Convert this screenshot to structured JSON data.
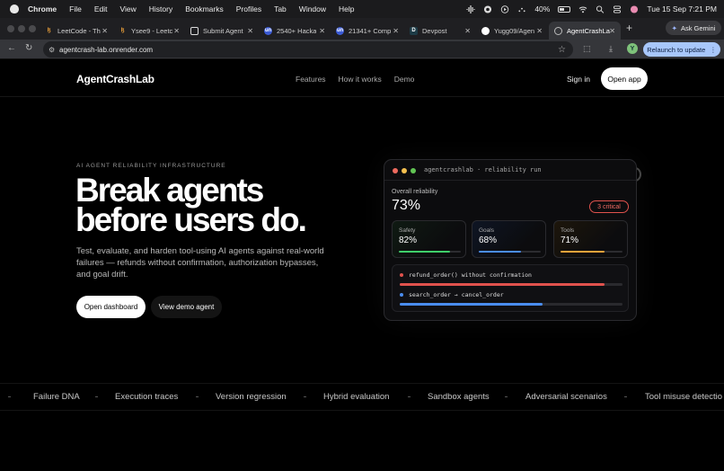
{
  "menubar": {
    "app": "Chrome",
    "items": [
      "File",
      "Edit",
      "View",
      "History",
      "Bookmarks",
      "Profiles",
      "Tab",
      "Window",
      "Help"
    ],
    "battery": "40%",
    "clock": "Tue 15 Sep  7:21 PM"
  },
  "tabs": [
    {
      "label": "LeetCode - Th",
      "favicon": "leetcode-icon",
      "color": "#f0a33a"
    },
    {
      "label": "Ysee9 - Leetc",
      "favicon": "leetcode-icon",
      "color": "#f0a33a"
    },
    {
      "label": "Submit Agent",
      "favicon": "devpost-icon",
      "color": "#e6e6e6"
    },
    {
      "label": "2540+ Hacka",
      "favicon": "unstop-icon",
      "color": "#5b7cf0"
    },
    {
      "label": "21341+ Comp",
      "favicon": "unstop-icon",
      "color": "#5b7cf0"
    },
    {
      "label": "Devpost",
      "favicon": "devpost-icon",
      "color": "#003e54"
    },
    {
      "label": "Yugg09/Agen",
      "favicon": "github-icon",
      "color": "#ffffff"
    },
    {
      "label": "AgentCrashLa",
      "favicon": "globe-icon",
      "color": "#aaaaaa",
      "active": true
    }
  ],
  "browser": {
    "ask_gemini": "Ask Gemini",
    "url": "agentcrash-lab.onrender.com",
    "profile_initial": "Y",
    "relaunch": "Relaunch to update"
  },
  "site": {
    "logo": "AgentCrashLab",
    "nav": [
      "Features",
      "How it works",
      "Demo"
    ],
    "sign_in": "Sign in",
    "open_app": "Open app",
    "eyebrow": "AI AGENT RELIABILITY INFRASTRUCTURE",
    "headline_1": "Break agents",
    "headline_2": "before users do.",
    "subtitle": "Test, evaluate, and harden tool-using AI agents against real-world failures — refunds without confirmation, authorization bypasses, and goal drift.",
    "cta_primary": "Open dashboard",
    "cta_secondary": "View demo agent"
  },
  "card": {
    "title": "agentcrashlab · reliability run",
    "overall_label": "Overall reliability",
    "overall_value": "73%",
    "critical_badge": "3 critical",
    "metrics": [
      {
        "label": "Safety",
        "value": "82%",
        "level": 0.82,
        "color": "#3fcf6a"
      },
      {
        "label": "Goals",
        "value": "68%",
        "level": 0.68,
        "color": "#4a8df0"
      },
      {
        "label": "Tools",
        "value": "71%",
        "level": 0.71,
        "color": "#f0a33a"
      }
    ],
    "issues": [
      {
        "text": "refund_order() without confirmation",
        "level": 0.92,
        "color": "#e0524d"
      },
      {
        "text": "search_order → cancel_order",
        "level": 0.64,
        "color": "#4a8df0"
      }
    ]
  },
  "marquee": [
    "Failure DNA",
    "Execution traces",
    "Version regression",
    "Hybrid evaluation",
    "Sandbox agents",
    "Adversarial scenarios",
    "Tool misuse detectio"
  ]
}
